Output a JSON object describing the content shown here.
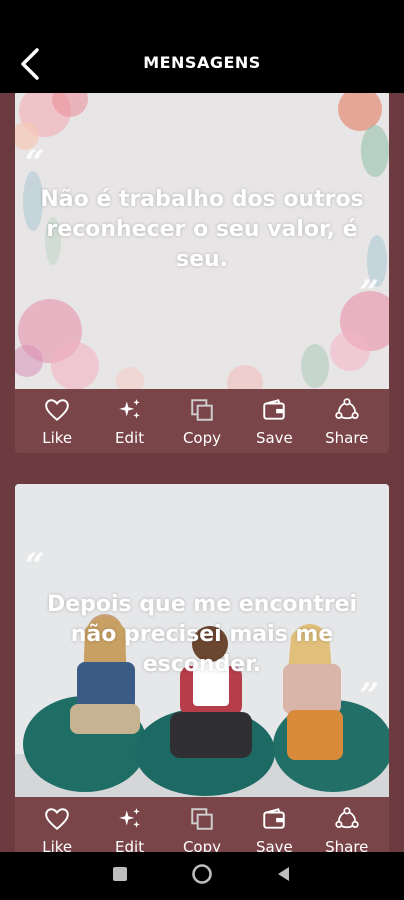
{
  "header": {
    "title": "MENSAGENS"
  },
  "cards": [
    {
      "quote": "Não é trabalho dos outros reconhecer o seu valor, é seu."
    },
    {
      "quote": "Depois que me encontrei não precisei mais me esconder."
    }
  ],
  "actions": {
    "like": "Like",
    "edit": "Edit",
    "copy": "Copy",
    "save": "Save",
    "share": "Share"
  },
  "colors": {
    "background": "#6b3b3f",
    "card": "#7a4548",
    "header": "#000000"
  },
  "icons": [
    "back-arrow-icon",
    "heart-icon",
    "sparkle-icon",
    "copy-icon",
    "wallet-icon",
    "share-icon",
    "square-icon",
    "circle-icon",
    "triangle-back-icon"
  ]
}
